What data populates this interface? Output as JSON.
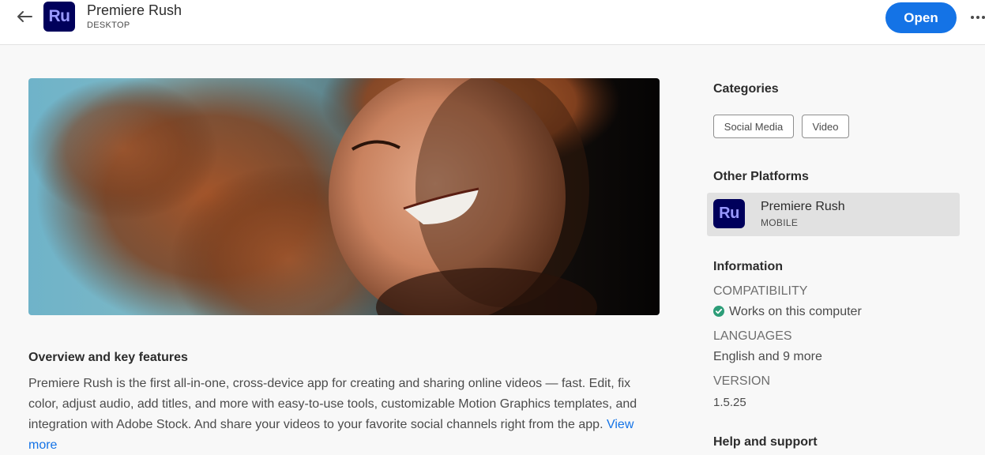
{
  "header": {
    "app_logo": "Ru",
    "app_title": "Premiere Rush",
    "app_platform": "DESKTOP",
    "open_label": "Open",
    "back_icon": "arrow-left-icon",
    "more_icon": "ellipsis-icon"
  },
  "overview": {
    "title": "Overview and key features",
    "description": "Premiere Rush is the first all-in-one, cross-device app for creating and sharing online videos — fast. Edit, fix color, adjust audio, add titles, and more with easy-to-use tools, customizable Motion Graphics templates, and integration with Adobe Stock. And share your videos to your favorite social channels right from the app.",
    "view_more": "View more"
  },
  "sidebar": {
    "categories_title": "Categories",
    "categories": [
      "Social Media",
      "Video"
    ],
    "other_platforms_title": "Other Platforms",
    "other_platform": {
      "logo": "Ru",
      "name": "Premiere Rush",
      "platform": "MOBILE"
    },
    "information_title": "Information",
    "compatibility_label": "COMPATIBILITY",
    "compatibility_value": "Works on this computer",
    "languages_label": "LANGUAGES",
    "languages_value": "English and 9 more",
    "version_label": "VERSION",
    "version_value": "1.5.25",
    "help_title": "Help and support"
  },
  "colors": {
    "accent": "#1473e6",
    "app_logo_bg": "#00005b",
    "app_logo_text": "#9999ff",
    "success": "#2d9d78"
  }
}
